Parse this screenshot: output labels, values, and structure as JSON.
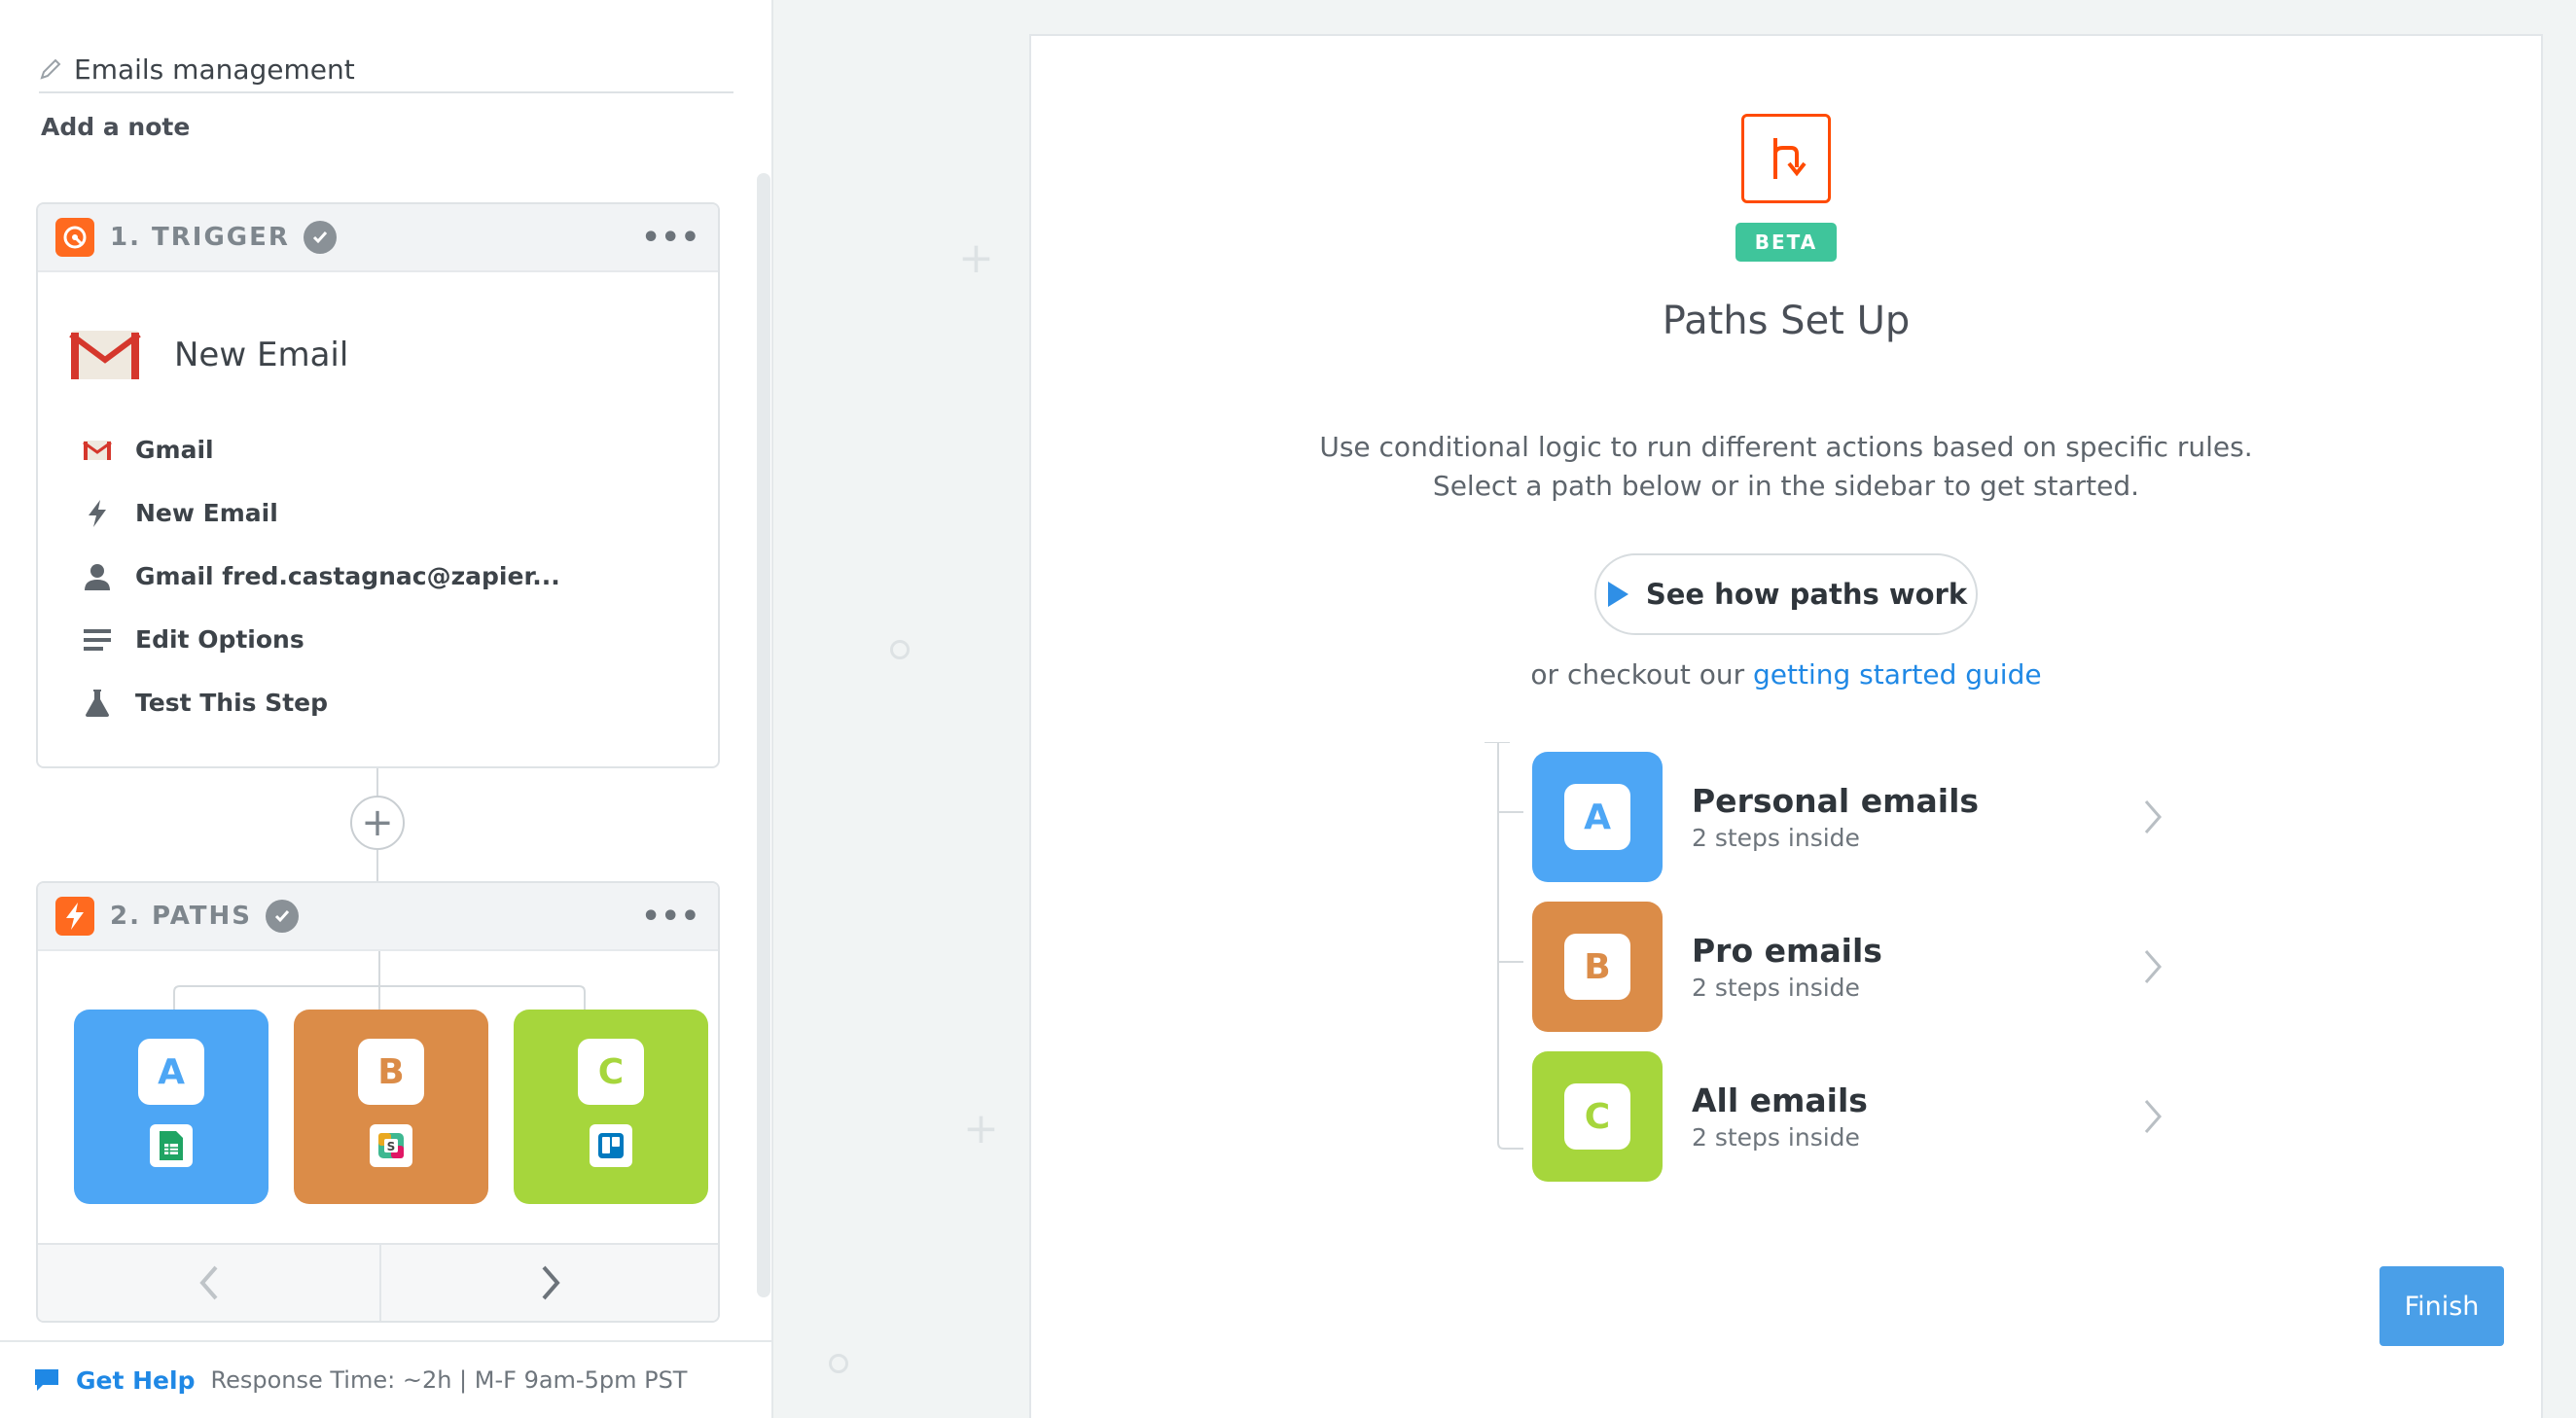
{
  "zap": {
    "title": "Emails management",
    "add_note": "Add a note"
  },
  "trigger": {
    "step_label": "1. TRIGGER",
    "title": "New Email",
    "options": [
      {
        "label": "Gmail",
        "icon": "gmail-icon"
      },
      {
        "label": "New Email",
        "icon": "bolt-icon"
      },
      {
        "label": "Gmail fred.castagnac@zapier...",
        "icon": "user-icon"
      },
      {
        "label": "Edit Options",
        "icon": "list-icon"
      },
      {
        "label": "Test This Step",
        "icon": "flask-icon"
      }
    ]
  },
  "paths_step": {
    "step_label": "2. PATHS",
    "tiles": [
      {
        "letter": "A",
        "color": "#4da6f5",
        "app_icon": "google-sheets-icon"
      },
      {
        "letter": "B",
        "color": "#db8c48",
        "app_icon": "slack-icon"
      },
      {
        "letter": "C",
        "color": "#a6d63c",
        "app_icon": "trello-icon"
      }
    ]
  },
  "help": {
    "link": "Get Help",
    "meta": "Response Time: ~2h | M-F 9am-5pm PST"
  },
  "panel": {
    "badge": "BETA",
    "title": "Paths Set Up",
    "desc_line1": "Use conditional logic to run different actions based on specific rules.",
    "desc_line2": "Select a path below or in the sidebar to get started.",
    "video_button": "See how paths work",
    "checkout_prefix": "or checkout our ",
    "checkout_link": "getting started guide",
    "paths": [
      {
        "letter": "A",
        "name": "Personal emails",
        "sub": "2 steps inside",
        "color": "#4da6f5"
      },
      {
        "letter": "B",
        "name": "Pro emails",
        "sub": "2 steps inside",
        "color": "#db8c48"
      },
      {
        "letter": "C",
        "name": "All emails",
        "sub": "2 steps inside",
        "color": "#a6d63c"
      }
    ],
    "finish": "Finish"
  },
  "colors": {
    "accent_blue": "#1f88e5",
    "brand_orange": "#ff4a00",
    "beta_green": "#3fc59b",
    "finish_blue": "#4a9fe8"
  }
}
